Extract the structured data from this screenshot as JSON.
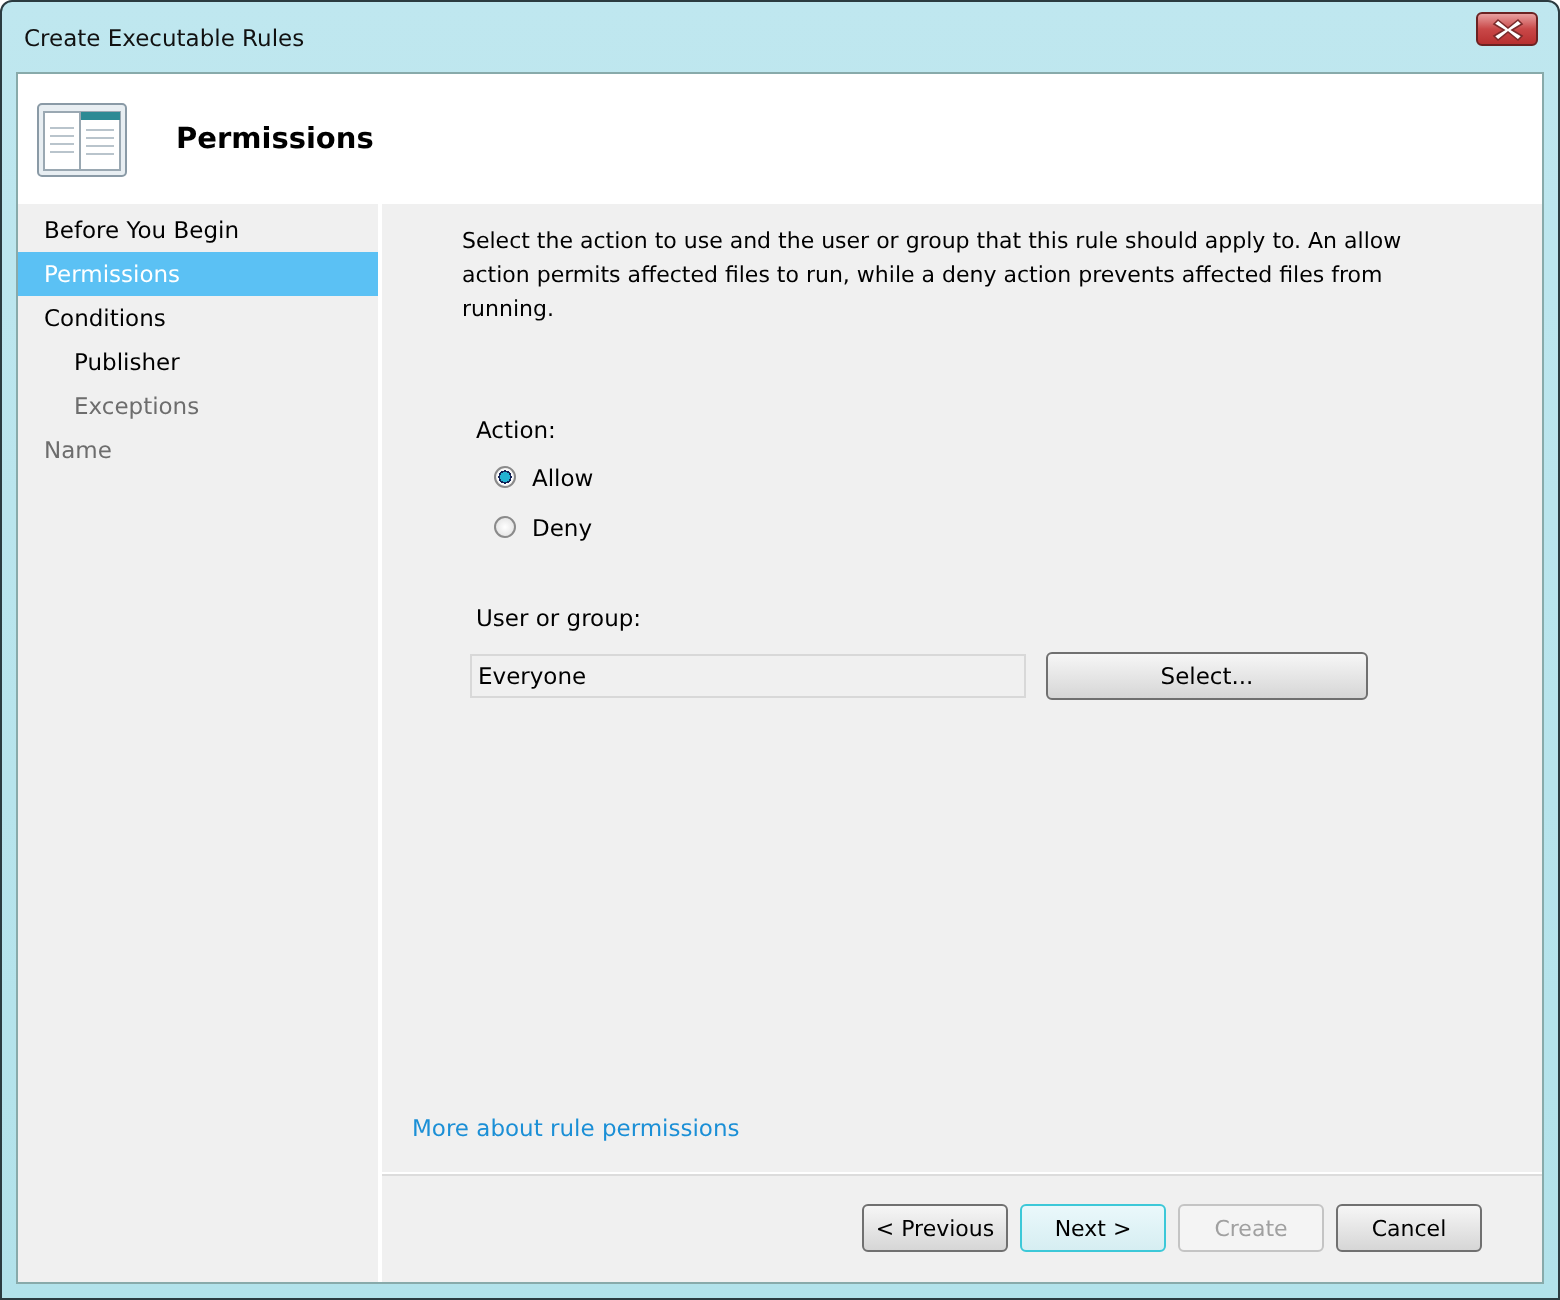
{
  "window": {
    "title": "Create Executable Rules"
  },
  "header": {
    "title": "Permissions"
  },
  "sidebar": {
    "items": [
      {
        "label": "Before You Begin",
        "selected": false,
        "disabled": false
      },
      {
        "label": "Permissions",
        "selected": true,
        "disabled": false
      },
      {
        "label": "Conditions",
        "selected": false,
        "disabled": false,
        "children": [
          {
            "label": "Publisher",
            "selected": false,
            "disabled": false
          },
          {
            "label": "Exceptions",
            "selected": false,
            "disabled": true
          }
        ]
      },
      {
        "label": "Name",
        "selected": false,
        "disabled": true
      }
    ]
  },
  "description": "Select the action to use and the user or group that this rule should apply to. An allow action permits affected files to run, while a deny action prevents affected files from running.",
  "action": {
    "label": "Action:",
    "options": [
      {
        "label": "Allow",
        "selected": true
      },
      {
        "label": "Deny",
        "selected": false
      }
    ]
  },
  "user_group": {
    "label": "User or group:",
    "value": "Everyone",
    "button": "Select..."
  },
  "help_link": "More about rule permissions",
  "buttons": [
    {
      "label": "< Previous",
      "disabled": false,
      "focused": false
    },
    {
      "label": "Next >",
      "disabled": false,
      "focused": true
    },
    {
      "label": "Create",
      "disabled": true,
      "focused": false
    },
    {
      "label": "Cancel",
      "disabled": false,
      "focused": false
    }
  ]
}
